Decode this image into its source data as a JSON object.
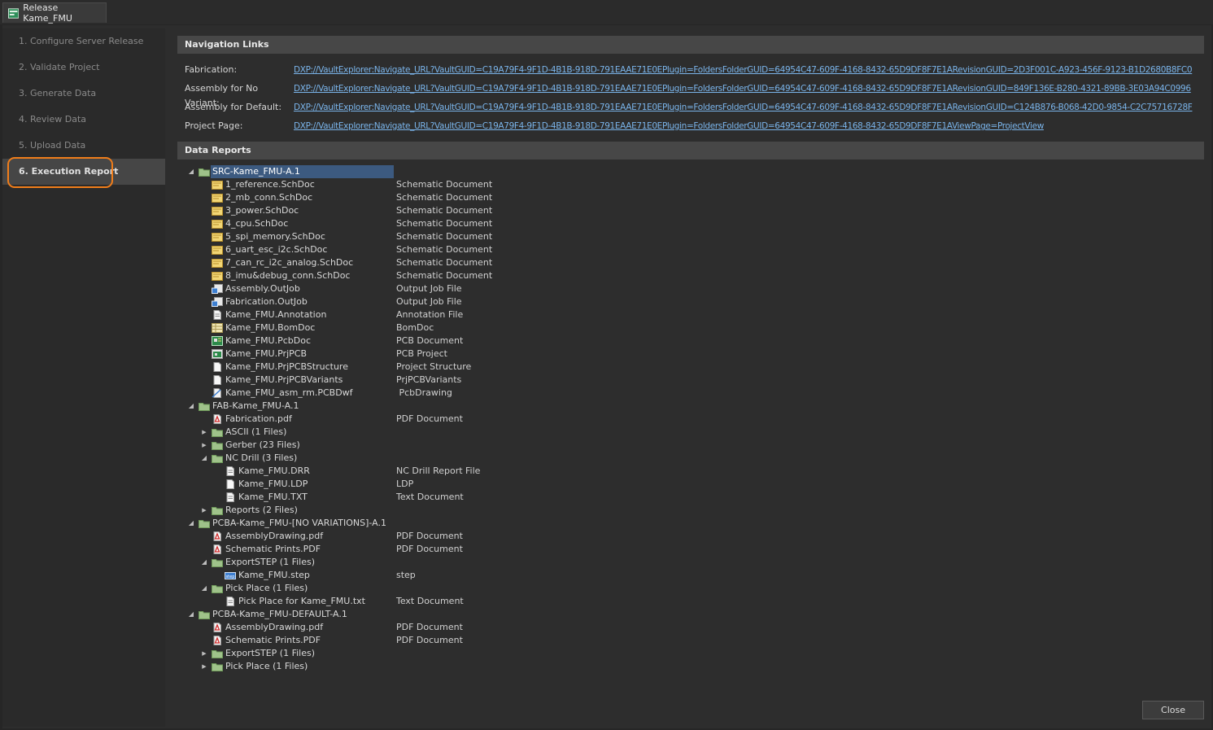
{
  "window": {
    "tab_title": "Release Kame_FMU"
  },
  "steps": [
    {
      "label": "1. Configure Server Release",
      "active": false
    },
    {
      "label": "2. Validate Project",
      "active": false
    },
    {
      "label": "3. Generate Data",
      "active": false
    },
    {
      "label": "4. Review Data",
      "active": false
    },
    {
      "label": "5. Upload Data",
      "active": false
    },
    {
      "label": "6. Execution Report",
      "active": true
    }
  ],
  "navigation": {
    "title": "Navigation Links",
    "links": [
      {
        "label": "Fabrication:",
        "url": "DXP://VaultExplorer:Navigate_URL?VaultGUID=C19A79F4-9F1D-4B1B-918D-791EAAE71E0EPlugin=FoldersFolderGUID=64954C47-609F-4168-8432-65D9DF8F7E1ARevisionGUID=2D3F001C-A923-456F-9123-B1D2680B8FC0"
      },
      {
        "label": "Assembly for No Variant:",
        "url": "DXP://VaultExplorer:Navigate_URL?VaultGUID=C19A79F4-9F1D-4B1B-918D-791EAAE71E0EPlugin=FoldersFolderGUID=64954C47-609F-4168-8432-65D9DF8F7E1ARevisionGUID=849F136E-B280-4321-89BB-3E03A94C0996"
      },
      {
        "label": "Assembly for Default:",
        "url": "DXP://VaultExplorer:Navigate_URL?VaultGUID=C19A79F4-9F1D-4B1B-918D-791EAAE71E0EPlugin=FoldersFolderGUID=64954C47-609F-4168-8432-65D9DF8F7E1ARevisionGUID=C124B876-B068-42D0-9854-C2C75716728F"
      },
      {
        "label": "Project Page:",
        "url": "DXP://VaultExplorer:Navigate_URL?VaultGUID=C19A79F4-9F1D-4B1B-918D-791EAAE71E0EPlugin=FoldersFolderGUID=64954C47-609F-4168-8432-65D9DF8F7E1AViewPage=ProjectView"
      }
    ]
  },
  "reports": {
    "title": "Data Reports",
    "rows": [
      {
        "level": 0,
        "expander": "open",
        "icon": "folder-icon",
        "name": "SRC-Kame_FMU-A.1",
        "type": "",
        "selected": true
      },
      {
        "level": 1,
        "expander": "none",
        "icon": "schematic-icon",
        "name": "1_reference.SchDoc",
        "type": "Schematic Document"
      },
      {
        "level": 1,
        "expander": "none",
        "icon": "schematic-icon",
        "name": "2_mb_conn.SchDoc",
        "type": "Schematic Document"
      },
      {
        "level": 1,
        "expander": "none",
        "icon": "schematic-icon",
        "name": "3_power.SchDoc",
        "type": "Schematic Document"
      },
      {
        "level": 1,
        "expander": "none",
        "icon": "schematic-icon",
        "name": "4_cpu.SchDoc",
        "type": "Schematic Document"
      },
      {
        "level": 1,
        "expander": "none",
        "icon": "schematic-icon",
        "name": "5_spi_memory.SchDoc",
        "type": "Schematic Document"
      },
      {
        "level": 1,
        "expander": "none",
        "icon": "schematic-icon",
        "name": "6_uart_esc_i2c.SchDoc",
        "type": "Schematic Document"
      },
      {
        "level": 1,
        "expander": "none",
        "icon": "schematic-icon",
        "name": "7_can_rc_i2c_analog.SchDoc",
        "type": "Schematic Document"
      },
      {
        "level": 1,
        "expander": "none",
        "icon": "schematic-icon",
        "name": "8_imu&debug_conn.SchDoc",
        "type": "Schematic Document"
      },
      {
        "level": 1,
        "expander": "none",
        "icon": "outjob-icon",
        "name": "Assembly.OutJob",
        "type": "Output Job File"
      },
      {
        "level": 1,
        "expander": "none",
        "icon": "outjob-icon",
        "name": "Fabrication.OutJob",
        "type": "Output Job File"
      },
      {
        "level": 1,
        "expander": "none",
        "icon": "document-icon",
        "name": "Kame_FMU.Annotation",
        "type": "Annotation File"
      },
      {
        "level": 1,
        "expander": "none",
        "icon": "bom-icon",
        "name": "Kame_FMU.BomDoc",
        "type": "BomDoc"
      },
      {
        "level": 1,
        "expander": "none",
        "icon": "pcb-icon",
        "name": "Kame_FMU.PcbDoc",
        "type": "PCB Document"
      },
      {
        "level": 1,
        "expander": "none",
        "icon": "pcb-project-icon",
        "name": "Kame_FMU.PrjPCB",
        "type": "PCB Project"
      },
      {
        "level": 1,
        "expander": "none",
        "icon": "blank-file-icon",
        "name": "Kame_FMU.PrjPCBStructure",
        "type": "Project Structure"
      },
      {
        "level": 1,
        "expander": "none",
        "icon": "blank-file-icon",
        "name": "Kame_FMU.PrjPCBVariants",
        "type": "PrjPCBVariants"
      },
      {
        "level": 1,
        "expander": "none",
        "icon": "drawing-icon",
        "name": "Kame_FMU_asm_rm.PCBDwf",
        "type": " PcbDrawing"
      },
      {
        "level": 0,
        "expander": "open",
        "icon": "folder-icon",
        "name": "FAB-Kame_FMU-A.1",
        "type": ""
      },
      {
        "level": 1,
        "expander": "none",
        "icon": "pdf-icon",
        "name": "Fabrication.pdf",
        "type": "PDF Document"
      },
      {
        "level": 1,
        "expander": "closed",
        "icon": "folder-icon",
        "name": "ASCII (1 Files)",
        "type": ""
      },
      {
        "level": 1,
        "expander": "closed",
        "icon": "folder-icon",
        "name": "Gerber (23 Files)",
        "type": ""
      },
      {
        "level": 1,
        "expander": "open",
        "icon": "folder-icon",
        "name": "NC Drill (3 Files)",
        "type": ""
      },
      {
        "level": 2,
        "expander": "none",
        "icon": "document-icon",
        "name": "Kame_FMU.DRR",
        "type": "NC Drill Report File"
      },
      {
        "level": 2,
        "expander": "none",
        "icon": "blank-file-icon",
        "name": "Kame_FMU.LDP",
        "type": "LDP"
      },
      {
        "level": 2,
        "expander": "none",
        "icon": "document-icon",
        "name": "Kame_FMU.TXT",
        "type": "Text Document"
      },
      {
        "level": 1,
        "expander": "closed",
        "icon": "folder-icon",
        "name": "Reports (2 Files)",
        "type": ""
      },
      {
        "level": 0,
        "expander": "open",
        "icon": "folder-icon",
        "name": "PCBA-Kame_FMU-[NO VARIATIONS]-A.1",
        "type": ""
      },
      {
        "level": 1,
        "expander": "none",
        "icon": "pdf-icon",
        "name": "AssemblyDrawing.pdf",
        "type": "PDF Document"
      },
      {
        "level": 1,
        "expander": "none",
        "icon": "pdf-icon",
        "name": "Schematic Prints.PDF",
        "type": "PDF Document"
      },
      {
        "level": 1,
        "expander": "open",
        "icon": "folder-icon",
        "name": "ExportSTEP (1 Files)",
        "type": ""
      },
      {
        "level": 2,
        "expander": "none",
        "icon": "step-icon",
        "name": "Kame_FMU.step",
        "type": "step"
      },
      {
        "level": 1,
        "expander": "open",
        "icon": "folder-icon",
        "name": "Pick Place (1 Files)",
        "type": ""
      },
      {
        "level": 2,
        "expander": "none",
        "icon": "document-icon",
        "name": "Pick Place for Kame_FMU.txt",
        "type": "Text Document"
      },
      {
        "level": 0,
        "expander": "open",
        "icon": "folder-icon",
        "name": "PCBA-Kame_FMU-DEFAULT-A.1",
        "type": ""
      },
      {
        "level": 1,
        "expander": "none",
        "icon": "pdf-icon",
        "name": "AssemblyDrawing.pdf",
        "type": "PDF Document"
      },
      {
        "level": 1,
        "expander": "none",
        "icon": "pdf-icon",
        "name": "Schematic Prints.PDF",
        "type": "PDF Document"
      },
      {
        "level": 1,
        "expander": "closed",
        "icon": "folder-icon",
        "name": "ExportSTEP (1 Files)",
        "type": ""
      },
      {
        "level": 1,
        "expander": "closed",
        "icon": "folder-icon",
        "name": "Pick Place (1 Files)",
        "type": ""
      }
    ]
  },
  "buttons": {
    "close": "Close"
  },
  "colors": {
    "accent_highlight": "#f07d1a",
    "link": "#7ab4ea",
    "selection": "#3c5a80"
  }
}
